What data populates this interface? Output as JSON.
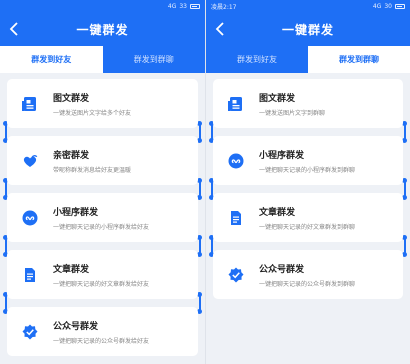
{
  "left": {
    "status": {
      "time": "",
      "signal": "4G",
      "battery": "33"
    },
    "nav_title": "一键群发",
    "tabs": [
      {
        "label": "群发到好友",
        "active": true
      },
      {
        "label": "群发到群聊",
        "active": false
      }
    ],
    "cards": [
      {
        "title": "图文群发",
        "desc": "一键发送图片文字给多个好友",
        "icon": "image-text-icon"
      },
      {
        "title": "亲密群发",
        "desc": "带昵称群发消息给好友更温暖",
        "icon": "hearts-icon"
      },
      {
        "title": "小程序群发",
        "desc": "一键把聊天记录的小程序群发给好友",
        "icon": "mini-program-icon"
      },
      {
        "title": "文章群发",
        "desc": "一键把聊天记录的好文章群发给好友",
        "icon": "article-icon"
      },
      {
        "title": "公众号群发",
        "desc": "一键把聊天记录的公众号群发给好友",
        "icon": "official-account-icon"
      }
    ]
  },
  "right": {
    "status": {
      "time": "凌晨2:17",
      "signal": "4G",
      "battery": "30"
    },
    "nav_title": "一键群发",
    "tabs": [
      {
        "label": "群发到好友",
        "active": false
      },
      {
        "label": "群发到群聊",
        "active": true
      }
    ],
    "cards": [
      {
        "title": "图文群发",
        "desc": "一键发送图片文字到群聊",
        "icon": "image-text-icon"
      },
      {
        "title": "小程序群发",
        "desc": "一键把聊天记录的小程序群发到群聊",
        "icon": "mini-program-icon"
      },
      {
        "title": "文章群发",
        "desc": "一键把聊天记录的好文章群发到群聊",
        "icon": "article-icon"
      },
      {
        "title": "公众号群发",
        "desc": "一键把聊天记录的公众号群发到群聊",
        "icon": "official-account-icon"
      }
    ]
  },
  "colors": {
    "primary": "#1e6ff5",
    "background": "#eef1f6"
  }
}
